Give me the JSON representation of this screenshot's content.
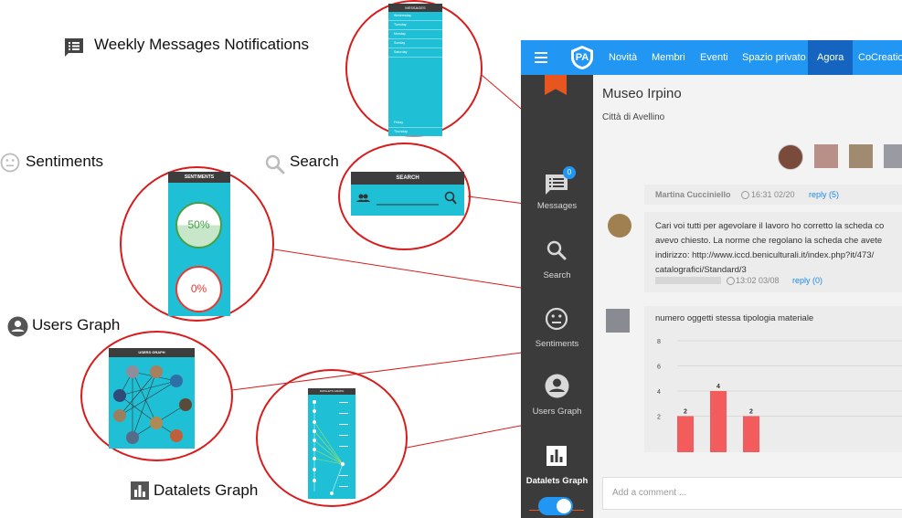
{
  "annotations": {
    "weekly_messages": "Weekly Messages Notifications",
    "sentiments": "Sentiments",
    "search": "Search",
    "users_graph": "Users Graph",
    "datalets_graph": "Datalets Graph"
  },
  "thumb_messages": {
    "header": "MESSAGES",
    "rows": [
      "Wednesday",
      "Tuesday",
      "Monday",
      "Sunday",
      "Saturday"
    ],
    "bottom_rows": [
      "Friday",
      "Thursday"
    ]
  },
  "thumb_search": {
    "header": "SEARCH"
  },
  "thumb_sentiments": {
    "header": "SENTIMENTS",
    "positive": "50%",
    "negative": "0%"
  },
  "thumb_users_graph": {
    "header": "USERS GRAPH"
  },
  "thumb_datalets_graph": {
    "header": "DATALETS GRAPH"
  },
  "app": {
    "logo_text": "PA",
    "nav": [
      "Novità",
      "Membri",
      "Eventi",
      "Spazio privato",
      "Agora",
      "CoCreation"
    ],
    "active_nav": "Agora",
    "sidebar": {
      "messages_label": "Messages",
      "messages_badge": "0",
      "search_label": "Search",
      "sentiments_label": "Sentiments",
      "users_graph_label": "Users Graph",
      "datalets_graph_label": "Datalets Graph"
    },
    "room_title": "Museo Irpino",
    "room_subtitle": "Città di Avellino",
    "post1": {
      "author": "Martina Cucciniello",
      "time": "16:31 02/20",
      "reply": "reply (5)"
    },
    "post2": {
      "lines": [
        "Cari voi tutti per agevolare il lavoro ho corretto la scheda co",
        "avevo chiesto. La norme che regolano la scheda che avete",
        "indirizzo: http://www.iccd.beniculturali.it/index.php?it/473/",
        "catalografici/Standard/3"
      ],
      "time": "13:02 03/08",
      "reply": "reply (0)"
    },
    "post3": {
      "text": "numero oggetti stessa tipologia materiale"
    },
    "comment_placeholder": "Add a comment ..."
  },
  "colors": {
    "accent": "#2196f3",
    "ring": "#d81c1c",
    "teal": "#1fc0d6",
    "bar": "#f25c5c",
    "orange": "#e8561f"
  },
  "chart_data": {
    "type": "bar",
    "title": "numero oggetti stessa tipologia materiale",
    "categories": [
      "",
      "",
      ""
    ],
    "values": [
      2,
      4,
      2
    ],
    "yticks": [
      2,
      4,
      6,
      8
    ],
    "ylim": [
      0,
      8
    ],
    "grid": true
  }
}
